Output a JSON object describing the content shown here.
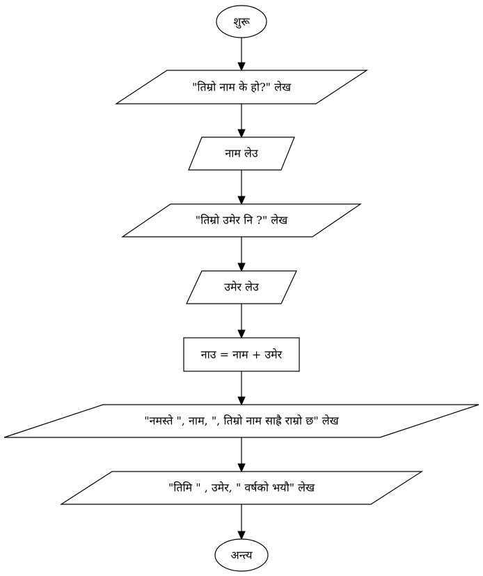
{
  "flowchart": {
    "nodes": [
      {
        "id": "start",
        "shape": "terminal",
        "label": "शुरू"
      },
      {
        "id": "out1",
        "shape": "parallelogram",
        "label": "\"तिम्रो नाम के हो?\" लेख"
      },
      {
        "id": "in1",
        "shape": "parallelogram",
        "label": "नाम लेउ"
      },
      {
        "id": "out2",
        "shape": "parallelogram",
        "label": "\"तिम्रो उमेर नि ?\" लेख"
      },
      {
        "id": "in2",
        "shape": "parallelogram",
        "label": "उमेर लेउ"
      },
      {
        "id": "proc1",
        "shape": "process",
        "label": "नाउ = नाम + उमेर"
      },
      {
        "id": "out3",
        "shape": "parallelogram",
        "label": "\"नमस्ते \", नाम, \", तिम्रो नाम साह्रै राम्रो छ\" लेख"
      },
      {
        "id": "out4",
        "shape": "parallelogram",
        "label": "\"तिमि \" , उमेर, \" वर्षको भयौ\" लेख"
      },
      {
        "id": "end",
        "shape": "terminal",
        "label": "अन्त्य"
      }
    ],
    "edges": [
      {
        "from": "start",
        "to": "out1"
      },
      {
        "from": "out1",
        "to": "in1"
      },
      {
        "from": "in1",
        "to": "out2"
      },
      {
        "from": "out2",
        "to": "in2"
      },
      {
        "from": "in2",
        "to": "proc1"
      },
      {
        "from": "proc1",
        "to": "out3"
      },
      {
        "from": "out3",
        "to": "out4"
      },
      {
        "from": "out4",
        "to": "end"
      }
    ]
  }
}
